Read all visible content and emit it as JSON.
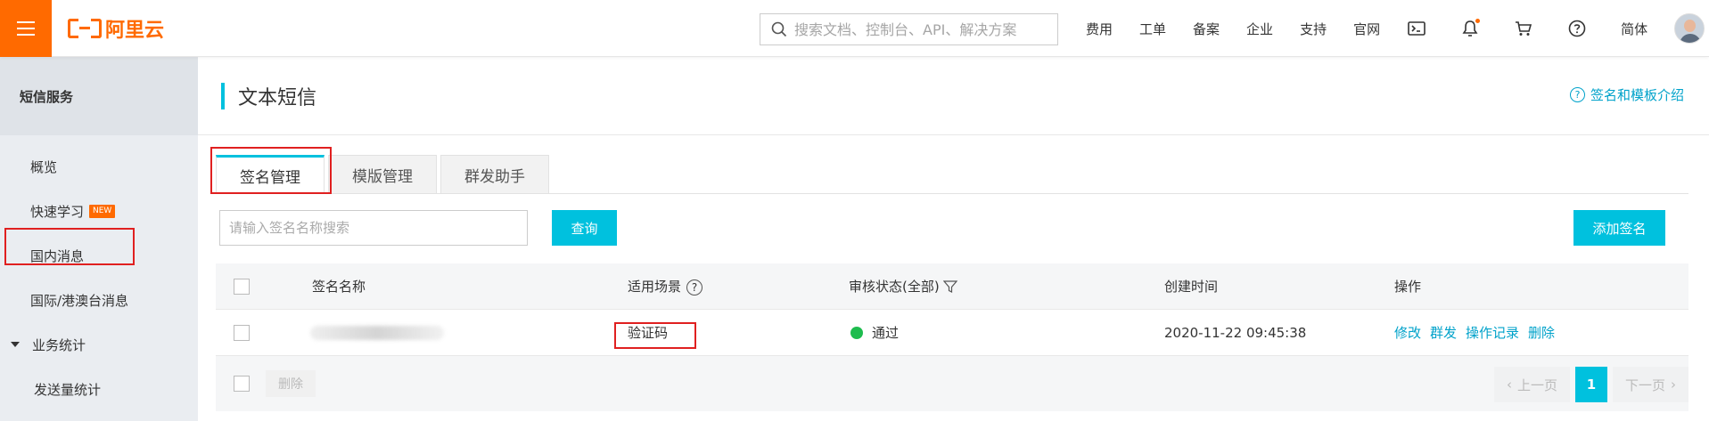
{
  "topbar": {
    "logo_text": "阿里云",
    "search_placeholder": "搜索文档、控制台、API、解决方案",
    "links": [
      "费用",
      "工单",
      "备案",
      "企业",
      "支持",
      "官网"
    ],
    "language": "简体"
  },
  "sidebar": {
    "header": "短信服务",
    "items": [
      {
        "label": "概览"
      },
      {
        "label": "快速学习",
        "badge": "NEW"
      },
      {
        "label": "国内消息"
      },
      {
        "label": "国际/港澳台消息"
      },
      {
        "label": "业务统计"
      },
      {
        "label": "发送量统计"
      }
    ]
  },
  "page": {
    "title": "文本短信",
    "help_link": "签名和模板介绍"
  },
  "tabs": [
    "签名管理",
    "模版管理",
    "群发助手"
  ],
  "filter": {
    "placeholder": "请输入签名名称搜索",
    "query_button": "查询",
    "add_button": "添加签名"
  },
  "table": {
    "headers": {
      "name": "签名名称",
      "scene": "适用场景",
      "status": "审核状态(全部)",
      "created": "创建时间",
      "actions": "操作"
    },
    "rows": [
      {
        "scene": "验证码",
        "status": "通过",
        "created": "2020-11-22 09:45:38",
        "actions": [
          "修改",
          "群发",
          "操作记录",
          "删除"
        ]
      }
    ]
  },
  "footer": {
    "delete_button": "删除",
    "prev": "上一页",
    "page": "1",
    "next": "下一页"
  },
  "colors": {
    "brand": "#ff6a00",
    "accent": "#00c1de",
    "link": "#00a2ca",
    "status_ok": "#1ebc4e",
    "highlight": "#e02020"
  }
}
